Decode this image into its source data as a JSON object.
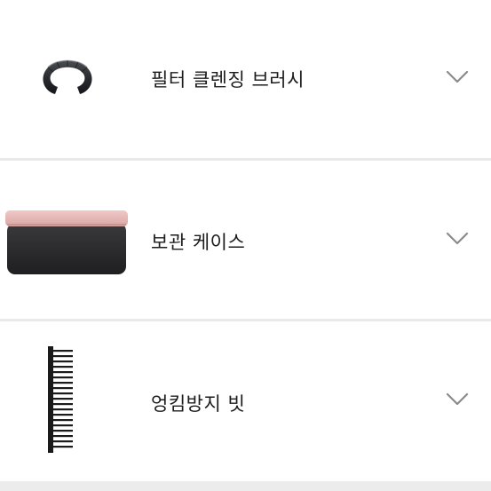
{
  "accessories": [
    {
      "label": "필터 클렌징 브러시",
      "icon": "cleaning-brush-ring-icon",
      "expanded": false
    },
    {
      "label": "보관 케이스",
      "icon": "storage-case-icon",
      "expanded": false
    },
    {
      "label": "엉킴방지 빗",
      "icon": "detangling-comb-icon",
      "expanded": false
    }
  ],
  "colors": {
    "divider": "#e9e9e9",
    "chevron": "#8a8a8a",
    "case_lid": "#e6b8b8",
    "case_body": "#2b2b2b"
  }
}
